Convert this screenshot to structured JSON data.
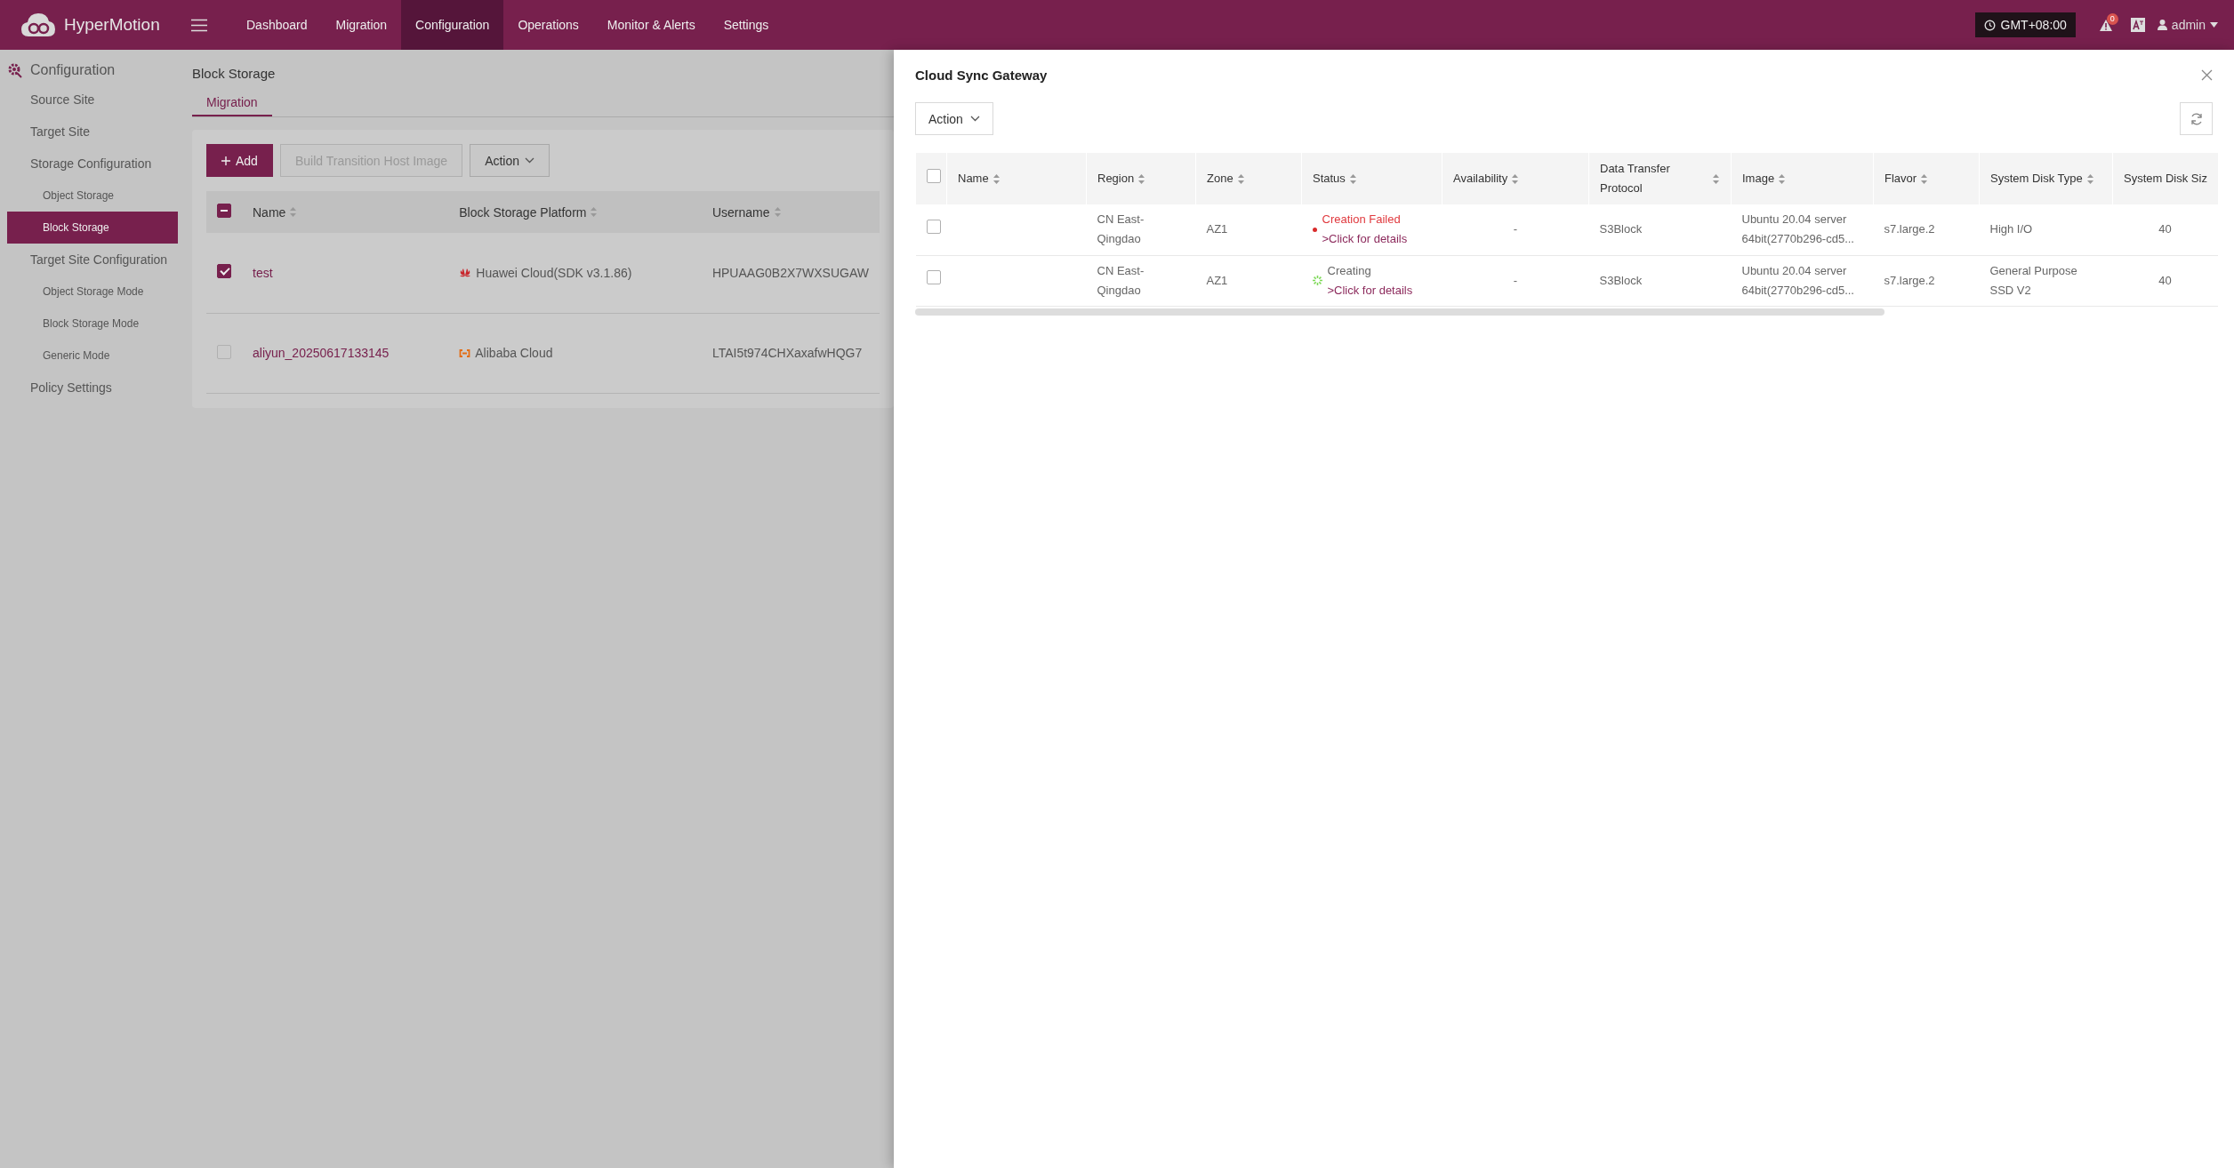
{
  "app": {
    "name": "HyperMotion"
  },
  "nav": [
    {
      "label": "Dashboard",
      "selected": false
    },
    {
      "label": "Migration",
      "selected": false
    },
    {
      "label": "Configuration",
      "selected": true
    },
    {
      "label": "Operations",
      "selected": false
    },
    {
      "label": "Monitor & Alerts",
      "selected": false
    },
    {
      "label": "Settings",
      "selected": false
    }
  ],
  "header_right": {
    "timezone": "GMT+08:00",
    "alert_count": "0",
    "user": "admin"
  },
  "sidebar": {
    "title": "Configuration",
    "items": [
      {
        "label": "Source Site",
        "selected": false
      },
      {
        "label": "Target Site",
        "selected": false
      },
      {
        "label": "Storage Configuration",
        "selected": false,
        "children": [
          {
            "label": "Object Storage",
            "selected": false
          },
          {
            "label": "Block Storage",
            "selected": true
          }
        ]
      },
      {
        "label": "Target Site Configuration",
        "selected": false,
        "children": [
          {
            "label": "Object Storage Mode",
            "selected": false
          },
          {
            "label": "Block Storage Mode",
            "selected": false
          },
          {
            "label": "Generic Mode",
            "selected": false
          }
        ]
      },
      {
        "label": "Policy Settings",
        "selected": false
      }
    ]
  },
  "page": {
    "title": "Block Storage",
    "tabs": [
      {
        "label": "Migration",
        "selected": true
      }
    ],
    "buttons": [
      {
        "label": "Add",
        "kind": "primary",
        "disabled": false
      },
      {
        "label": "Build Transition Host Image",
        "kind": "default",
        "disabled": true
      },
      {
        "label": "Action",
        "kind": "dropdown",
        "disabled": false
      }
    ],
    "table": {
      "select_all": {
        "indeterminate": true
      },
      "columns": [
        "Name",
        "Block Storage Platform",
        "Username"
      ],
      "rows": [
        {
          "checked": true,
          "name": "test",
          "platform": "Huawei Cloud(SDK v3.1.86)",
          "kind": "huawei",
          "username": "HPUAAG0B2X7WXSUGAW"
        },
        {
          "checked": false,
          "name": "aliyun_20250617133145",
          "platform": "Alibaba Cloud",
          "kind": "alibaba",
          "username": "LTAI5t974CHXaxafwHQG7"
        }
      ]
    }
  },
  "drawer": {
    "title": "Cloud Sync Gateway",
    "action": "Action",
    "table": {
      "select_all": {
        "checked": false
      },
      "columns": [
        "Name",
        "Region",
        "Zone",
        "Status",
        "Availability",
        "Data Transfer Protocol",
        "Image",
        "Flavor",
        "System Disk Type",
        "System Disk Siz"
      ],
      "rows": [
        {
          "checked": false,
          "region": "CN East-Qingdao",
          "zone": "AZ1",
          "status": {
            "kind": "failed",
            "label": "Creation Failed",
            "link": ">Click for details"
          },
          "availability": "-",
          "protocol": "S3Block",
          "image": "Ubuntu 20.04 server 64bit(2770b296-cd5...",
          "flavor": "s7.large.2",
          "disk_type": "High I/O",
          "disk_size": "40"
        },
        {
          "checked": false,
          "region": "CN East-Qingdao",
          "zone": "AZ1",
          "status": {
            "kind": "creating",
            "label": "Creating",
            "link": ">Click for details"
          },
          "availability": "-",
          "protocol": "S3Block",
          "image": "Ubuntu 20.04 server 64bit(2770b296-cd5...",
          "flavor": "s7.large.2",
          "disk_type": "General Purpose SSD V2",
          "disk_size": "40"
        }
      ]
    }
  }
}
